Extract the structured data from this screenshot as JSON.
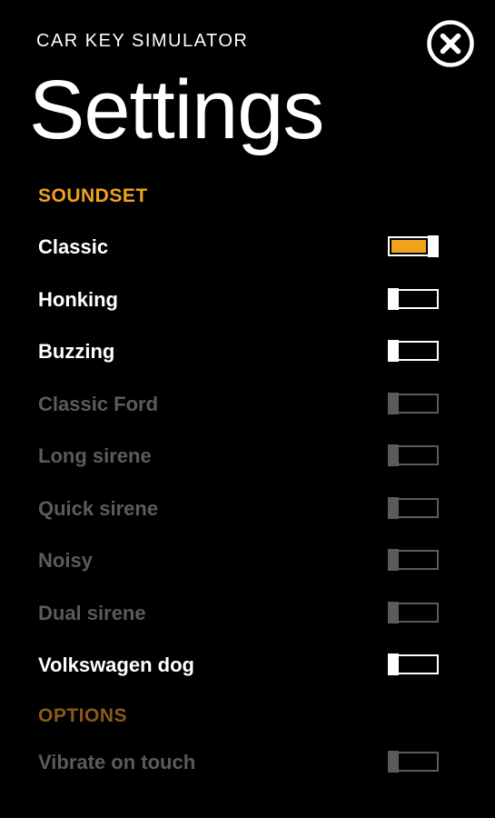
{
  "header": {
    "app_name": "CAR KEY SIMULATOR",
    "title": "Settings",
    "close_icon": "close-circle-icon"
  },
  "colors": {
    "background": "#000000",
    "accent": "#f0a21b",
    "section_header_dim": "#8a5a1a",
    "text_enabled": "#ffffff",
    "text_disabled": "#5b5b5b"
  },
  "soundset": {
    "label": "SOUNDSET",
    "items": [
      {
        "label": "Classic",
        "checked": true,
        "enabled": true
      },
      {
        "label": "Honking",
        "checked": false,
        "enabled": true
      },
      {
        "label": "Buzzing",
        "checked": false,
        "enabled": true
      },
      {
        "label": "Classic Ford",
        "checked": false,
        "enabled": false
      },
      {
        "label": "Long sirene",
        "checked": false,
        "enabled": false
      },
      {
        "label": "Quick sirene",
        "checked": false,
        "enabled": false
      },
      {
        "label": "Noisy",
        "checked": false,
        "enabled": false
      },
      {
        "label": "Dual sirene",
        "checked": false,
        "enabled": false
      },
      {
        "label": "Volkswagen dog",
        "checked": false,
        "enabled": true
      }
    ]
  },
  "options": {
    "label": "OPTIONS",
    "items": [
      {
        "label": "Vibrate on touch",
        "checked": false,
        "enabled": false
      }
    ]
  }
}
